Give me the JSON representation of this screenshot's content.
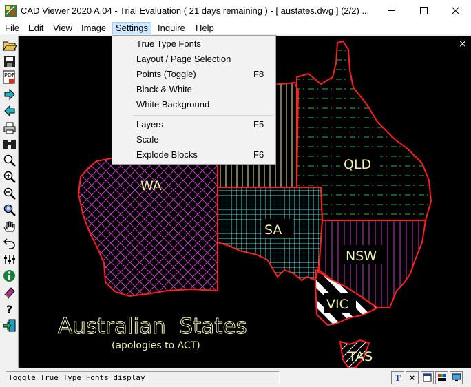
{
  "window": {
    "title": "CAD Viewer 2020 A.04 - Trial Evaluation ( 21 days remaining )  -  [ austates.dwg ] (2/2) ...",
    "controls": [
      "minimize",
      "maximize",
      "close"
    ]
  },
  "menubar": {
    "items": [
      "File",
      "Edit",
      "View",
      "Image",
      "Settings",
      "Inquire",
      "Help"
    ],
    "active": "Settings"
  },
  "settings_menu": {
    "items": [
      {
        "label": "True Type Fonts",
        "shortcut": ""
      },
      {
        "label": "Layout / Page Selection",
        "shortcut": ""
      },
      {
        "label": "Points (Toggle)",
        "shortcut": "F8"
      },
      {
        "label": "Black & White",
        "shortcut": ""
      },
      {
        "label": "White Background",
        "shortcut": ""
      },
      {
        "label": "Layers",
        "shortcut": "F5"
      },
      {
        "label": "Scale",
        "shortcut": ""
      },
      {
        "label": "Explode Blocks",
        "shortcut": "F6"
      }
    ]
  },
  "toolbar": {
    "icons": [
      "open-folder-icon",
      "save-icon",
      "pdf-icon",
      "next-arrow-icon",
      "prev-arrow-icon",
      "print-icon",
      "binoculars-icon",
      "zoom-icon",
      "zoom-in-icon",
      "zoom-out-icon",
      "zoom-window-icon",
      "pan-hand-icon",
      "undo-icon",
      "layers-icon",
      "info-icon",
      "book-icon",
      "help-icon",
      "exit-icon"
    ]
  },
  "drawing": {
    "states": [
      "WA",
      "QLD",
      "SA",
      "NSW",
      "VIC",
      "TAS"
    ],
    "title": "Australian  States",
    "subtitle": "(apologies to ACT)",
    "close_glyph": "×"
  },
  "statusbar": {
    "message": "Toggle True Type Fonts display",
    "buttons": [
      "T",
      "×"
    ]
  },
  "colors": {
    "border_red": "#ff2020",
    "wa_hatch": "#c040c0",
    "qld_hatch": "#20c040",
    "sa_hatch": "#30e0e0",
    "nsw_hatch": "#c040c0",
    "nt_hatch": "#f0f0a0",
    "text": "#f0f0b0"
  }
}
